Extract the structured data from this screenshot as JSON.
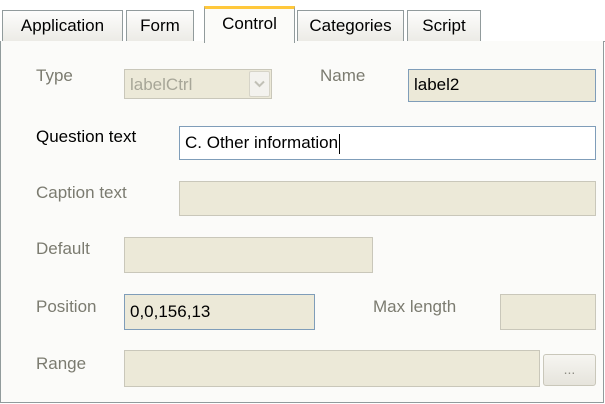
{
  "tabs": [
    "Application",
    "Form",
    "Control",
    "Categories",
    "Script"
  ],
  "active_tab": "Control",
  "type": {
    "label": "Type",
    "value": "labelCtrl",
    "enabled": false
  },
  "name": {
    "label": "Name",
    "value": "label2"
  },
  "question_text": {
    "label": "Question text",
    "value": "C. Other information"
  },
  "caption_text": {
    "label": "Caption text",
    "value": ""
  },
  "default": {
    "label": "Default",
    "value": ""
  },
  "position": {
    "label": "Position",
    "value": "0,0,156,13"
  },
  "max_length": {
    "label": "Max length",
    "value": ""
  },
  "range": {
    "label": "Range",
    "value": "",
    "button_label": "..."
  },
  "icons": {
    "dropdown": "chevron-down-icon"
  },
  "colors": {
    "active_tab_accent": "#ffc83c",
    "disabled_field": "#ece9d8",
    "field_border": "#7f9db9"
  }
}
